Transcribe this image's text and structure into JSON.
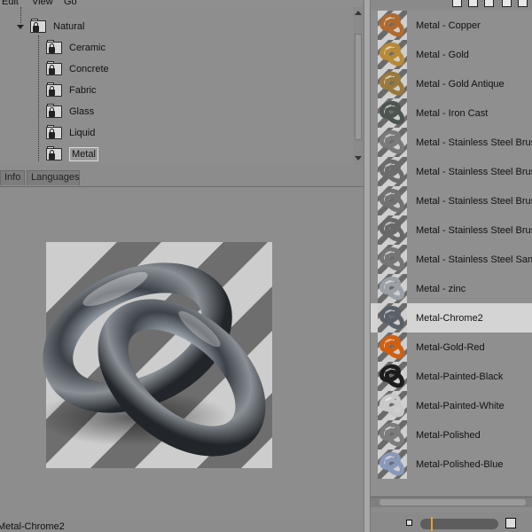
{
  "menu": {
    "items": [
      "Edit",
      "View",
      "Go"
    ]
  },
  "tree": {
    "parent": "Natural",
    "children": [
      "Ceramic",
      "Concrete",
      "Fabric",
      "Glass",
      "Liquid",
      "Metal"
    ],
    "selected": "Metal"
  },
  "tabs": [
    "Info",
    "Languages"
  ],
  "preview": {
    "status": "Metal-Chrome2"
  },
  "materials": [
    {
      "label": "Metal - Copper",
      "color": "#b06a2e"
    },
    {
      "label": "Metal - Gold",
      "color": "#b88a35"
    },
    {
      "label": "Metal - Gold Antique",
      "color": "#9a7a3a"
    },
    {
      "label": "Metal - Iron Cast",
      "color": "#4c5550"
    },
    {
      "label": "Metal - Stainless Steel Brushed",
      "color": "#7a7a7a"
    },
    {
      "label": "Metal - Stainless Steel Brushed",
      "color": "#6c6c6c"
    },
    {
      "label": "Metal - Stainless Steel Brushed",
      "color": "#727272"
    },
    {
      "label": "Metal - Stainless Steel Brushed",
      "color": "#686868"
    },
    {
      "label": "Metal - Stainless Steel Sandblasted",
      "color": "#757575"
    },
    {
      "label": "Metal - zinc",
      "color": "#9aa0a6"
    },
    {
      "label": "Metal-Chrome2",
      "color": "#5a6068",
      "selected": true
    },
    {
      "label": "Metal-Gold-Red",
      "color": "#d06010"
    },
    {
      "label": "Metal-Painted-Black",
      "color": "#1c1c1c"
    },
    {
      "label": "Metal-Painted-White",
      "color": "#c8c8c8"
    },
    {
      "label": "Metal-Polished",
      "color": "#7c7c7c"
    },
    {
      "label": "Metal-Polished-Blue",
      "color": "#8898b8"
    }
  ]
}
